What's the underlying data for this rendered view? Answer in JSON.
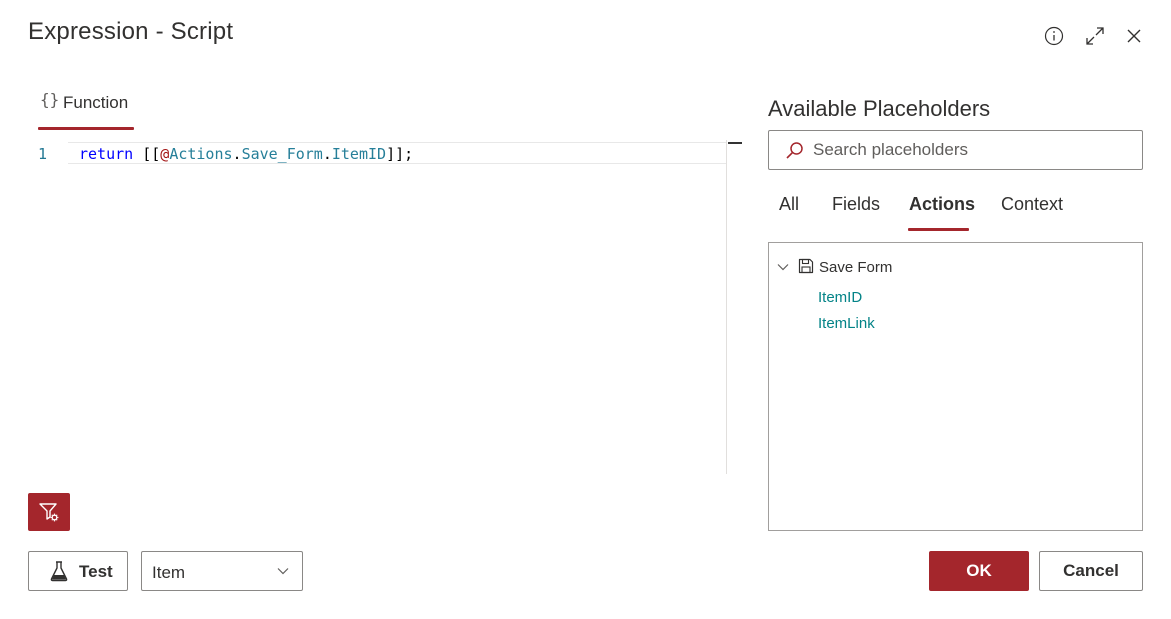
{
  "dialog": {
    "title": "Expression - Script"
  },
  "header_icons": {
    "info": "info-icon",
    "expand": "expand-icon",
    "close": "close-icon"
  },
  "function_tab": {
    "icon_text": "{}",
    "label": "Function"
  },
  "editor": {
    "lines": [
      {
        "number": "1",
        "tokens": {
          "keyword": "return",
          "open": " [[",
          "at": "@",
          "ref1": "Actions",
          "dot1": ".",
          "ref2": "Save_Form",
          "dot2": ".",
          "ref3": "ItemID",
          "close": "]];"
        }
      }
    ]
  },
  "footer": {
    "test_label": "Test",
    "item_select_value": "Item",
    "ok_label": "OK",
    "cancel_label": "Cancel"
  },
  "placeholders": {
    "title": "Available Placeholders",
    "search_placeholder": "Search placeholders",
    "tabs": [
      {
        "label": "All",
        "active": false
      },
      {
        "label": "Fields",
        "active": false
      },
      {
        "label": "Actions",
        "active": true
      },
      {
        "label": "Context",
        "active": false
      }
    ],
    "tree": {
      "node_label": "Save Form",
      "children": [
        "ItemID",
        "ItemLink"
      ]
    }
  },
  "colors": {
    "accent": "#a4262c",
    "link": "#038387",
    "keyword": "#0000ff",
    "reference": "#267f99"
  }
}
